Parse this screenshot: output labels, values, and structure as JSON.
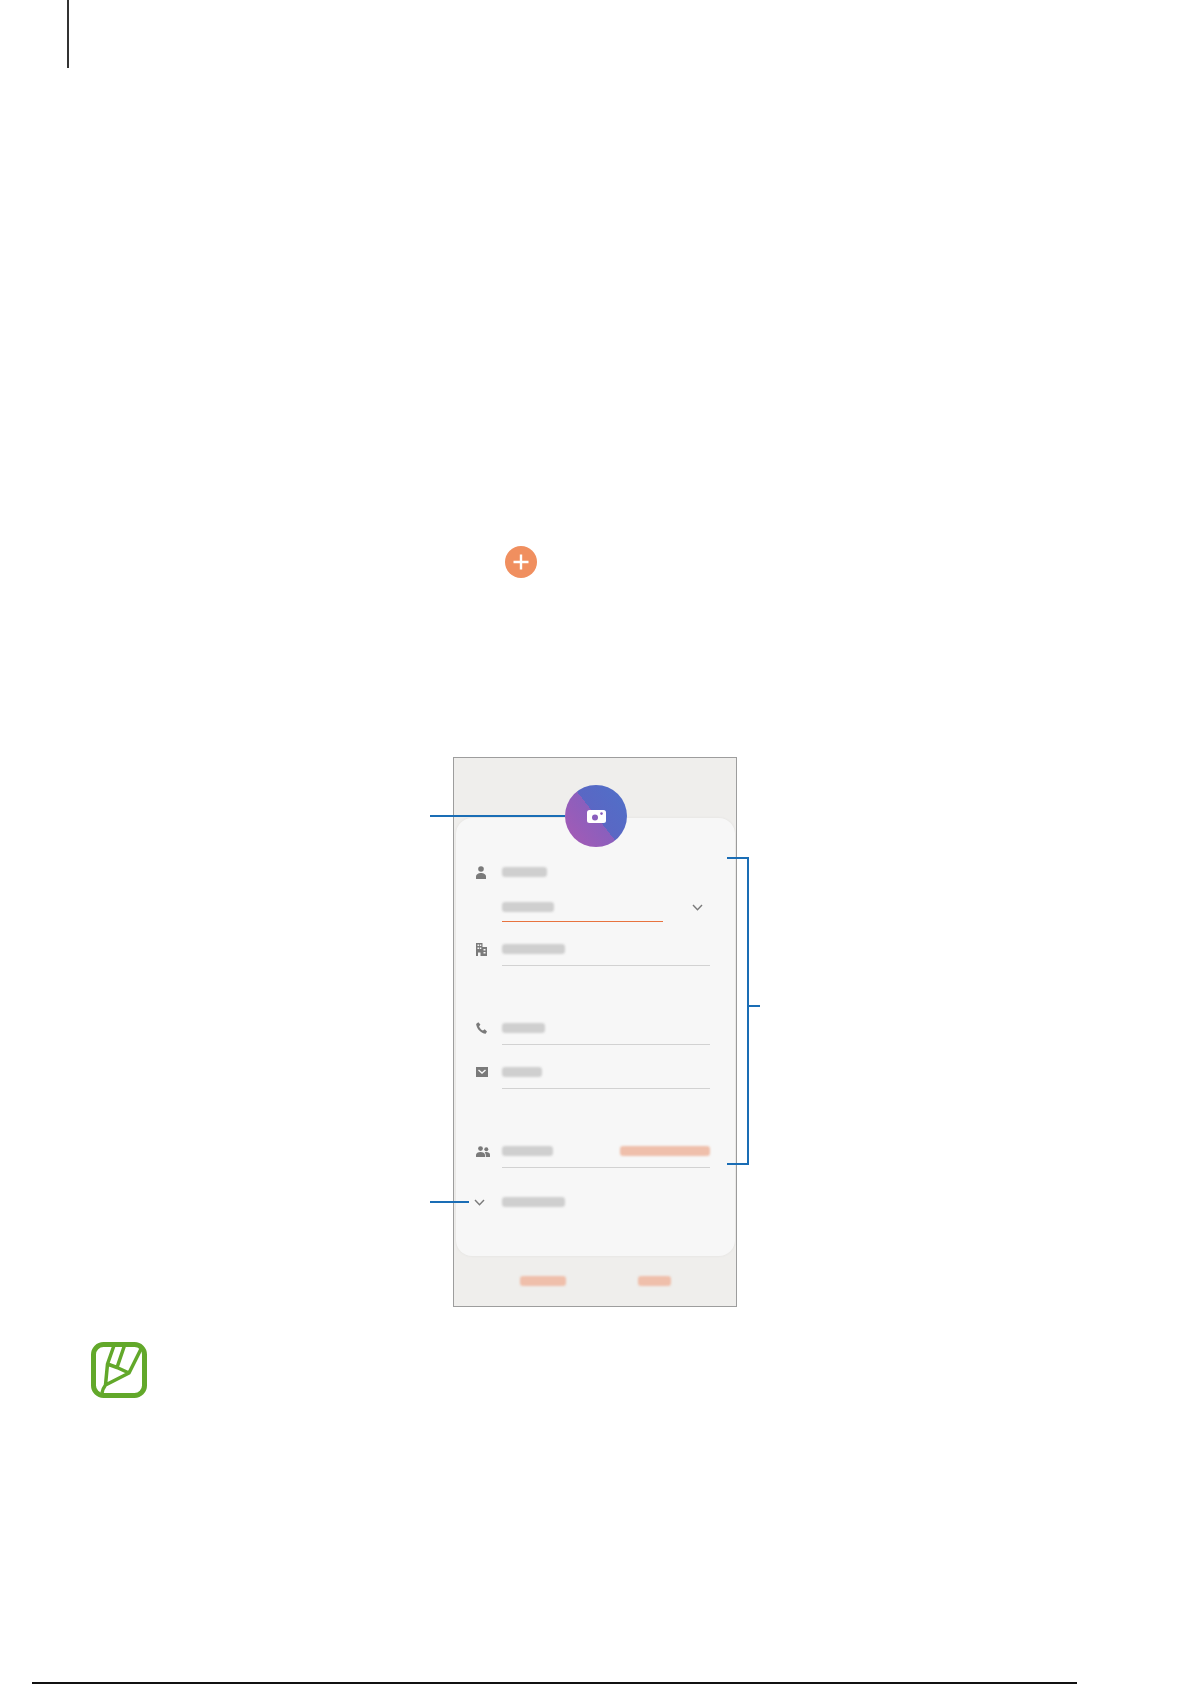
{
  "screen": {
    "sections": [
      {
        "fields": [
          {
            "kind": "name",
            "focused": true
          },
          {
            "kind": "organization",
            "focused": false
          }
        ]
      },
      {
        "fields": [
          {
            "kind": "phone",
            "focused": false
          },
          {
            "kind": "email",
            "focused": false
          }
        ]
      },
      {
        "fields": [
          {
            "kind": "groups",
            "focused": false
          }
        ]
      }
    ],
    "more_fields": {
      "expanded": false
    }
  }
}
